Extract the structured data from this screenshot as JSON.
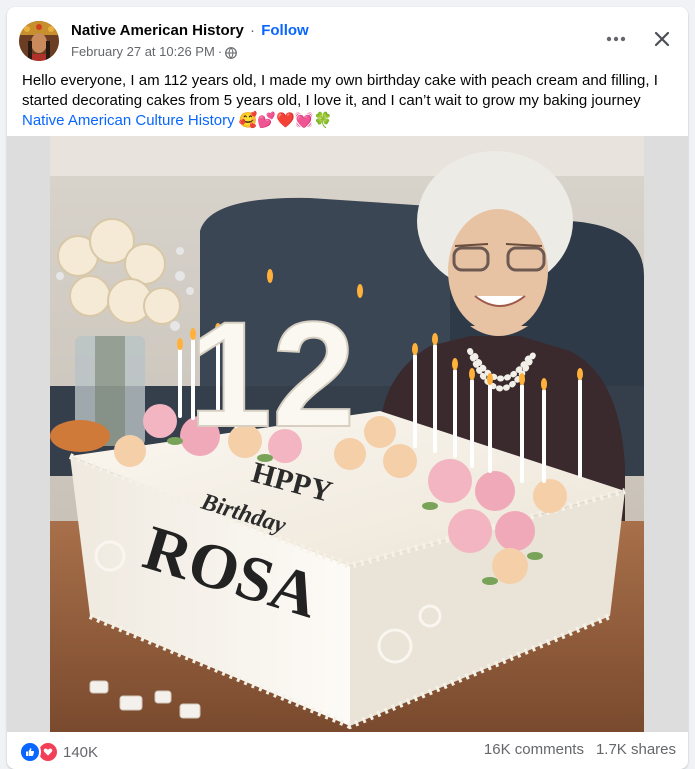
{
  "post": {
    "author": "Native American History",
    "separator": "·",
    "follow_label": "Follow",
    "date": "February 27 at 10:26 PM",
    "date_separator": "·",
    "audience_icon": "globe-icon",
    "body_text": "Hello everyone, I am 112 years old, I made my own birthday cake with peach cream and filling, I started decorating cakes from 5 years old, I love it, and I can’t wait to grow my baking journey ",
    "hashtag": "Native American Culture History",
    "emojis": "🥰💕❤️💓🍀",
    "more_icon": "more-horizontal-icon",
    "close_icon": "close-icon"
  },
  "image": {
    "cake_line1": "HPPY",
    "cake_line2": "Birthday",
    "cake_name": "ROSA",
    "candle_number": "12"
  },
  "footer": {
    "reaction_count": "140K",
    "comments": "16K comments",
    "shares": "1.7K shares",
    "reaction_icons": [
      "like-icon",
      "love-icon"
    ]
  },
  "colors": {
    "link": "#0866ff",
    "secondary_text": "#65676b",
    "like": "#0866ff",
    "love": "#f33e58"
  }
}
